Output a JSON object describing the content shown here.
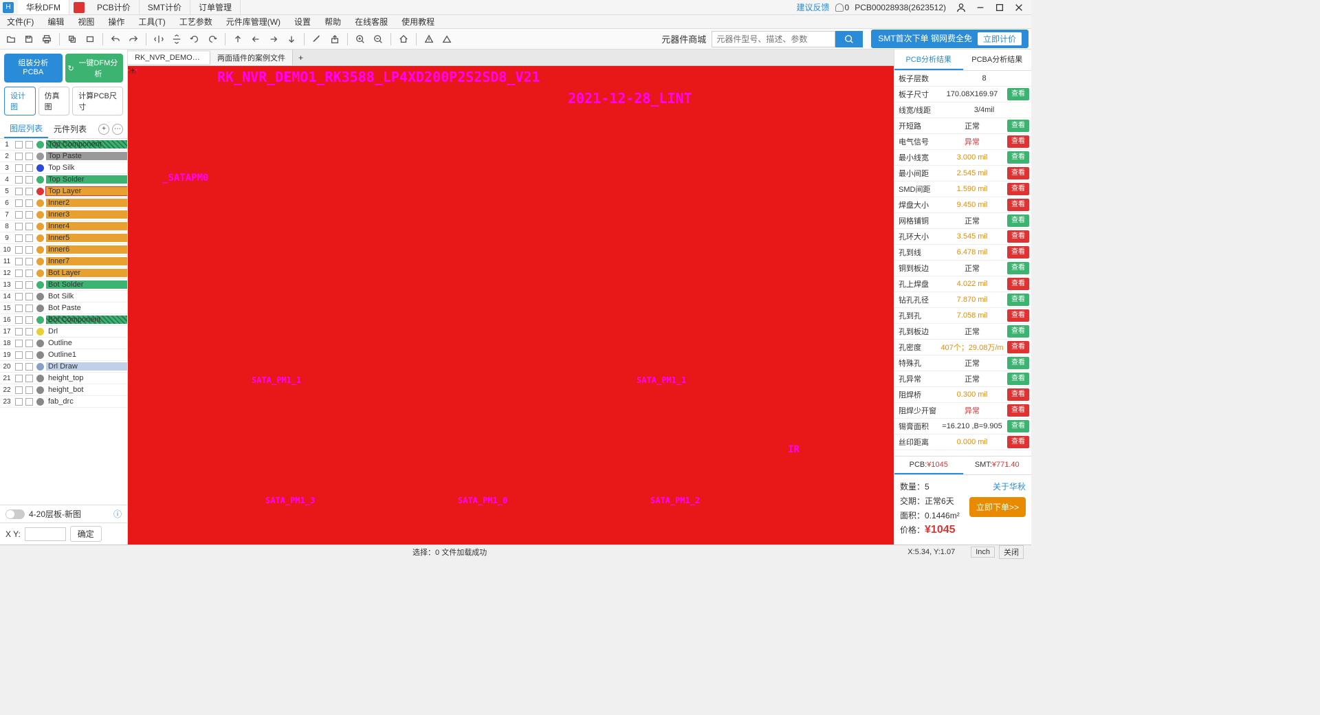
{
  "titlebar": {
    "app_name": "华秋DFM",
    "tabs": [
      "PCB计价",
      "SMT计价",
      "订单管理"
    ],
    "feedback": "建议反馈",
    "notif_count": "0",
    "job_id": "PCB00028938(2623512)"
  },
  "menubar": [
    "文件(F)",
    "编辑",
    "视图",
    "操作",
    "工具(T)",
    "工艺参数",
    "元件库管理(W)",
    "设置",
    "帮助",
    "在线客服",
    "使用教程"
  ],
  "toolbar": {
    "mall": "元器件商城",
    "search_placeholder": "元器件型号、描述、参数",
    "promo1": "SMT首次下单 钢网费全免",
    "promo_quote": "立即计价"
  },
  "file_tabs": [
    "RK_NVR_DEMO1_RK3...",
    "两面插件的案例文件"
  ],
  "left": {
    "btn_assembly": "组装分析 PCBA",
    "btn_dfm": "一键DFM分析",
    "btn_design": "设计图",
    "btn_sim": "仿真图",
    "btn_calc": "计算PCB尺寸",
    "tab_layers": "图层列表",
    "tab_components": "元件列表",
    "bottom_label": "4-20层板-新图",
    "xy_label": "X Y:",
    "ok": "确定",
    "layers": [
      {
        "n": "1",
        "name": "Top Component",
        "bg": "#3cb371",
        "dot": "#3cb371",
        "hatch": true
      },
      {
        "n": "2",
        "name": "Top Paste",
        "bg": "#999",
        "dot": "#999"
      },
      {
        "n": "3",
        "name": "Top Silk",
        "bg": "",
        "dot": "#2a4bd8"
      },
      {
        "n": "4",
        "name": "Top Solder",
        "bg": "#3cb371",
        "dot": "#3cb371"
      },
      {
        "n": "5",
        "name": "Top Layer",
        "bg": "#e8a030",
        "dot": "#d33",
        "sel": true
      },
      {
        "n": "6",
        "name": "Inner2",
        "bg": "#e8a030",
        "dot": "#e8a030"
      },
      {
        "n": "7",
        "name": "Inner3",
        "bg": "#e8a030",
        "dot": "#e8a030"
      },
      {
        "n": "8",
        "name": "Inner4",
        "bg": "#e8a030",
        "dot": "#e8a030"
      },
      {
        "n": "9",
        "name": "Inner5",
        "bg": "#e8a030",
        "dot": "#e8a030"
      },
      {
        "n": "10",
        "name": "Inner6",
        "bg": "#e8a030",
        "dot": "#e8a030"
      },
      {
        "n": "11",
        "name": "Inner7",
        "bg": "#e8a030",
        "dot": "#e8a030"
      },
      {
        "n": "12",
        "name": "Bot Layer",
        "bg": "#e8a030",
        "dot": "#e8a030"
      },
      {
        "n": "13",
        "name": "Bot Solder",
        "bg": "#3cb371",
        "dot": "#3cb371"
      },
      {
        "n": "14",
        "name": "Bot Silk",
        "bg": "",
        "dot": "#888"
      },
      {
        "n": "15",
        "name": "Bot Paste",
        "bg": "",
        "dot": "#888"
      },
      {
        "n": "16",
        "name": "Bot Component",
        "bg": "#3cb371",
        "dot": "#3cb371",
        "hatch": true
      },
      {
        "n": "17",
        "name": "Drl",
        "bg": "",
        "dot": "#e8d030"
      },
      {
        "n": "18",
        "name": "Outline",
        "bg": "",
        "dot": "#888"
      },
      {
        "n": "19",
        "name": "Outline1",
        "bg": "",
        "dot": "#888"
      },
      {
        "n": "20",
        "name": "Drl Draw",
        "bg": "#c0d0e8",
        "dot": "#88a0c8"
      },
      {
        "n": "21",
        "name": "height_top",
        "bg": "",
        "dot": "#888"
      },
      {
        "n": "22",
        "name": "height_bot",
        "bg": "",
        "dot": "#888"
      },
      {
        "n": "23",
        "name": "fab_drc",
        "bg": "",
        "dot": "#888"
      }
    ]
  },
  "canvas": {
    "text1": "RK_NVR_DEMO1_RK3588_LP4XD200P2S2SD8_V21",
    "text2": "2021-12-28_LINT",
    "text3": "_SATAPM0",
    "text4": "SATA_PM1_1",
    "text5": "SATA_PM1_1",
    "text6": "SATA_PM1_3",
    "text7": "SATA_PM1_0",
    "text8": "SATA_PM1_2",
    "text9": "IR"
  },
  "right": {
    "tab_pcb": "PCB分析结果",
    "tab_pcba": "PCBA分析结果",
    "params": [
      {
        "label": "板子层数",
        "val": "8",
        "btn": ""
      },
      {
        "label": "板子尺寸",
        "val": "170.08X169.97",
        "btn": "g",
        "btntxt": "查看"
      },
      {
        "label": "线宽/线距",
        "val": "3/4mil",
        "btn": ""
      },
      {
        "label": "开短路",
        "val": "正常",
        "btn": "g",
        "btntxt": "查看"
      },
      {
        "label": "电气信号",
        "val": "异常",
        "cls": "red",
        "btn": "r",
        "btntxt": "查看"
      },
      {
        "label": "最小线宽",
        "val": "3.000 mil",
        "cls": "orange",
        "btn": "g",
        "btntxt": "查看"
      },
      {
        "label": "最小间距",
        "val": "2.545 mil",
        "cls": "orange",
        "btn": "r",
        "btntxt": "查看"
      },
      {
        "label": "SMD间距",
        "val": "1.590 mil",
        "cls": "orange",
        "btn": "r",
        "btntxt": "查看"
      },
      {
        "label": "焊盘大小",
        "val": "9.450 mil",
        "cls": "orange",
        "btn": "r",
        "btntxt": "查看"
      },
      {
        "label": "网格铺铜",
        "val": "正常",
        "btn": "g",
        "btntxt": "查看"
      },
      {
        "label": "孔环大小",
        "val": "3.545 mil",
        "cls": "orange",
        "btn": "r",
        "btntxt": "查看"
      },
      {
        "label": "孔到线",
        "val": "6.478 mil",
        "cls": "orange",
        "btn": "r",
        "btntxt": "查看"
      },
      {
        "label": "铜到板边",
        "val": "正常",
        "btn": "g",
        "btntxt": "查看"
      },
      {
        "label": "孔上焊盘",
        "val": "4.022 mil",
        "cls": "orange",
        "btn": "r",
        "btntxt": "查看"
      },
      {
        "label": "钻孔孔径",
        "val": "7.870 mil",
        "cls": "orange",
        "btn": "g",
        "btntxt": "查看"
      },
      {
        "label": "孔到孔",
        "val": "7.058 mil",
        "cls": "orange",
        "btn": "r",
        "btntxt": "查看"
      },
      {
        "label": "孔到板边",
        "val": "正常",
        "btn": "g",
        "btntxt": "查看"
      },
      {
        "label": "孔密度",
        "val": "407个；29.08万/m",
        "cls": "orange",
        "btn": "r",
        "btntxt": "查看"
      },
      {
        "label": "特殊孔",
        "val": "正常",
        "btn": "g",
        "btntxt": "查看"
      },
      {
        "label": "孔异常",
        "val": "正常",
        "btn": "g",
        "btntxt": "查看"
      },
      {
        "label": "阻焊桥",
        "val": "0.300 mil",
        "cls": "orange",
        "btn": "r",
        "btntxt": "查看"
      },
      {
        "label": "阻焊少开窗",
        "val": "异常",
        "cls": "red",
        "btn": "r",
        "btntxt": "查看"
      },
      {
        "label": "锡膏面积",
        "val": "=16.210 ,B=9.905",
        "btn": "g",
        "btntxt": "查看"
      },
      {
        "label": "丝印距离",
        "val": "0.000 mil",
        "cls": "orange",
        "btn": "r",
        "btntxt": "查看"
      }
    ],
    "price_pcb_label": "PCB:",
    "price_pcb": "¥1045",
    "price_smt_label": "SMT:",
    "price_smt": "¥771.40",
    "qty_label": "数量：",
    "qty": "5",
    "about": "关于华秋",
    "deliv_label": "交期：",
    "deliv": "正常6天",
    "area_label": "面积：",
    "area": "0.1446m²",
    "order_btn": "立即下单>>",
    "price_label": "价格：",
    "price": "¥1045"
  },
  "statusbar": {
    "sel": "选择：0 文件加载成功",
    "coord": "X:5.34, Y:1.07",
    "unit1": "Inch",
    "unit2": "关闭"
  }
}
